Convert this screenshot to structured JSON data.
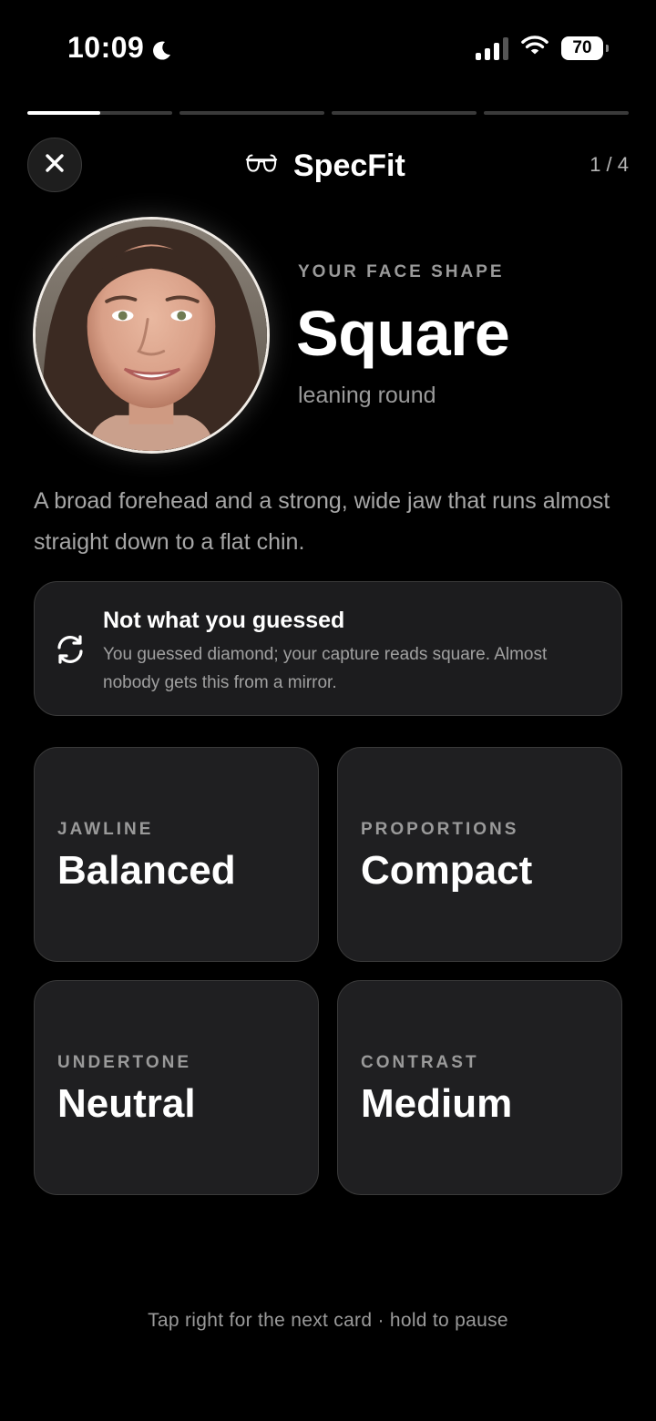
{
  "status_bar": {
    "time": "10:09",
    "battery": "70",
    "icons": [
      "moon-icon",
      "cellular-signal-icon",
      "wifi-icon",
      "battery-icon"
    ]
  },
  "progress": {
    "total_cards": 4,
    "current_card": 1,
    "current_fill_fraction": 0.5
  },
  "header": {
    "close_icon": "close-icon",
    "brand_icon": "glasses-icon",
    "brand_name": "SpecFit",
    "counter": "1 / 4"
  },
  "result": {
    "label": "YOUR FACE SHAPE",
    "shape": "Square",
    "qualifier": "leaning round",
    "description": "A broad forehead and a strong, wide jaw that runs almost straight down to a flat chin."
  },
  "guess_card": {
    "icon": "refresh-icon",
    "title": "Not what you guessed",
    "body": "You guessed diamond; your capture reads square. Almost nobody gets this from a mirror."
  },
  "attributes": [
    {
      "label": "JAWLINE",
      "value": "Balanced"
    },
    {
      "label": "PROPORTIONS",
      "value": "Compact"
    },
    {
      "label": "UNDERTONE",
      "value": "Neutral"
    },
    {
      "label": "CONTRAST",
      "value": "Medium"
    }
  ],
  "hint": "Tap right for the next card · hold to pause",
  "colors": {
    "background": "#000000",
    "card": "#1c1c1e",
    "border": "#3a3a3a",
    "muted_text": "#9a9a9a"
  }
}
